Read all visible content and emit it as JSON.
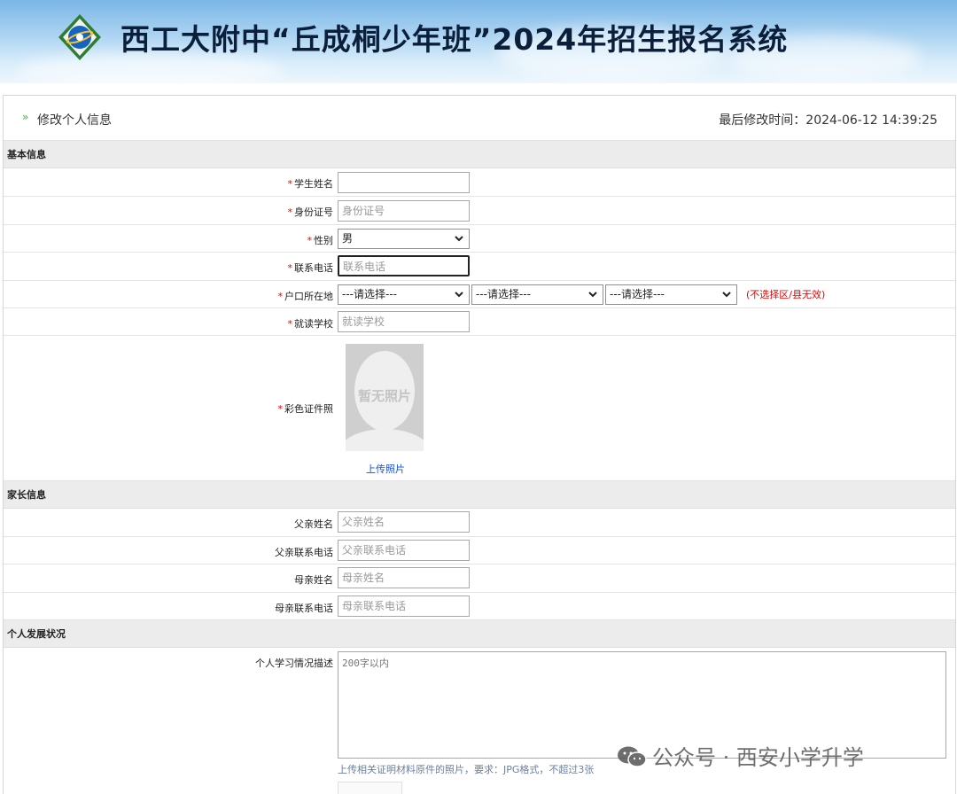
{
  "header": {
    "title": "西工大附中“丘成桐少年班”2024年招生报名系统",
    "logo_icon": "school-emblem-icon"
  },
  "panel": {
    "title": "修改个人信息",
    "last_modified": "最后修改时间：2024-06-12 14:39:25",
    "arrow_icon": "double-chevron-right-icon"
  },
  "basic": {
    "section": "基本信息",
    "name_label": "学生姓名",
    "name_value": "",
    "id_label": "身份证号",
    "id_placeholder": "身份证号",
    "gender_label": "性别",
    "gender_value": "男",
    "phone_label": "联系电话",
    "phone_placeholder": "联系电话",
    "hukou_label": "户口所在地",
    "hukou_selects": [
      "---请选择---",
      "---请选择---",
      "---请选择---"
    ],
    "hukou_hint": "(不选择区/县无效)",
    "school_label": "就读学校",
    "school_placeholder": "就读学校",
    "photo_label": "彩色证件照",
    "photo_text": "暂无照片",
    "upload_label": "上传照片"
  },
  "parents": {
    "section": "家长信息",
    "father_name_label": "父亲姓名",
    "father_name_placeholder": "父亲姓名",
    "father_phone_label": "父亲联系电话",
    "father_phone_placeholder": "父亲联系电话",
    "mother_name_label": "母亲姓名",
    "mother_name_placeholder": "母亲姓名",
    "mother_phone_label": "母亲联系电话",
    "mother_phone_placeholder": "母亲联系电话"
  },
  "development": {
    "section": "个人发展状况",
    "desc_label": "个人学习情况描述",
    "desc_placeholder": "200字以内",
    "note": "上传相关证明材料原件的照片，要求：JPG格式，不超过3张"
  },
  "watermark": {
    "text": "公众号 · 西安小学升学",
    "icon": "wechat-icon"
  },
  "required_mark": "*",
  "colors": {
    "required": "#ee0000",
    "link": "#1a4fd6",
    "accent_arrow": "#4caf50"
  }
}
